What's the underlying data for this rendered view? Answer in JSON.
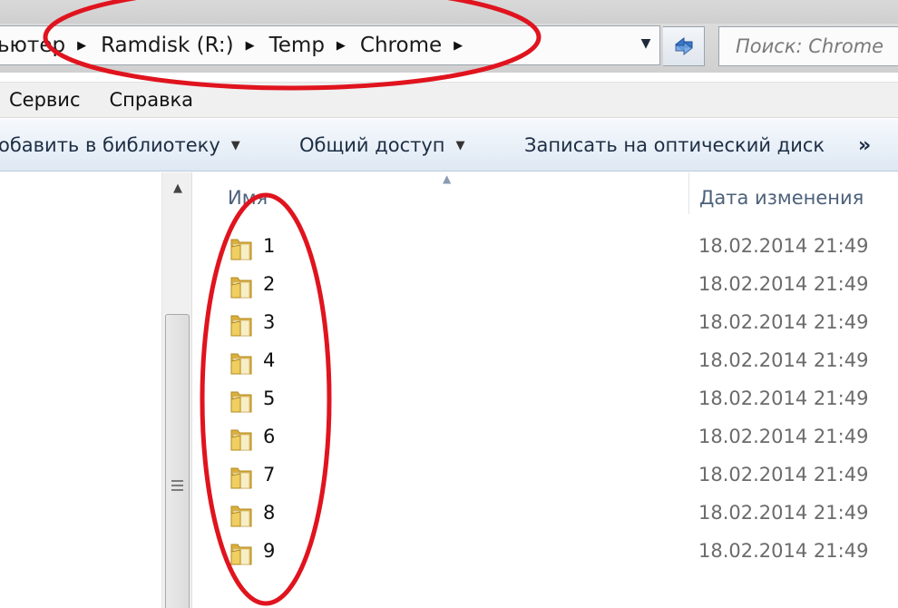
{
  "address_bar": {
    "breadcrumbs": [
      {
        "label": "ьютер"
      },
      {
        "label": "Ramdisk (R:)"
      },
      {
        "label": "Temp"
      },
      {
        "label": "Chrome"
      }
    ]
  },
  "search": {
    "placeholder": "Поиск: Chrome"
  },
  "menu": {
    "items": [
      {
        "label": "Сервис"
      },
      {
        "label": "Справка"
      }
    ]
  },
  "toolbar": {
    "add_to_library_label": "обавить в библиотеку",
    "share_label": "Общий доступ",
    "burn_label": "Записать на оптический диск",
    "more_label": "»"
  },
  "file_list": {
    "columns": {
      "name": "Имя",
      "date_modified": "Дата изменения"
    },
    "rows": [
      {
        "name": "1",
        "date": "18.02.2014 21:49"
      },
      {
        "name": "2",
        "date": "18.02.2014 21:49"
      },
      {
        "name": "3",
        "date": "18.02.2014 21:49"
      },
      {
        "name": "4",
        "date": "18.02.2014 21:49"
      },
      {
        "name": "5",
        "date": "18.02.2014 21:49"
      },
      {
        "name": "6",
        "date": "18.02.2014 21:49"
      },
      {
        "name": "7",
        "date": "18.02.2014 21:49"
      },
      {
        "name": "8",
        "date": "18.02.2014 21:49"
      },
      {
        "name": "9",
        "date": "18.02.2014 21:49"
      }
    ]
  },
  "icons": {
    "folder": "folder-icon",
    "refresh": "refresh-icon",
    "breadcrumb_separator": "chevron-right-icon",
    "dropdown": "chevron-down-icon"
  },
  "colors": {
    "annotation_red": "#e0141e",
    "folder_yellow": "#e8c65a",
    "header_text": "#4c607a"
  }
}
